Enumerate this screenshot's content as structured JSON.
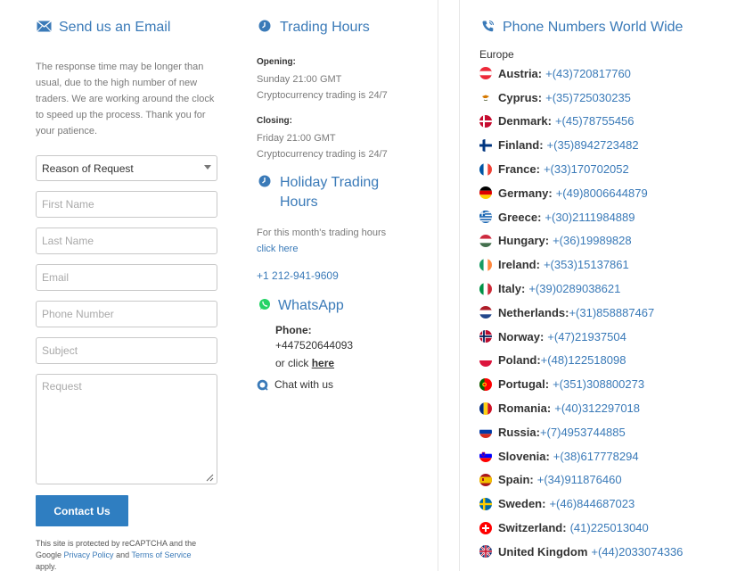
{
  "email_section": {
    "title": "Send us an Email",
    "intro": "The response time may be longer than usual, due to the high number of new traders. We are working around the clock to speed up the process. Thank you for your patience.",
    "select_value": "Reason of Request",
    "placeholders": {
      "first_name": "First Name",
      "last_name": "Last Name",
      "email": "Email",
      "phone": "Phone Number",
      "subject": "Subject",
      "request": "Request"
    },
    "submit_label": "Contact Us",
    "recaptcha_pre": "This site is protected by reCAPTCHA and the Google",
    "privacy_link": "Privacy Policy",
    "and_text": "and",
    "terms_link": "Terms of Service",
    "apply_text": "apply."
  },
  "trading_hours": {
    "title": "Trading Hours",
    "opening_label": "Opening:",
    "opening_time": "Sunday 21:00 GMT",
    "opening_note": "Cryptocurrency trading is 24/7",
    "closing_label": "Closing:",
    "closing_time": "Friday 21:00 GMT",
    "closing_note": "Cryptocurrency trading is 24/7"
  },
  "holiday_hours": {
    "title": "Holiday Trading Hours",
    "text": "For this month's trading hours",
    "link": "click here",
    "phone": "+1 212-941-9609"
  },
  "whatsapp": {
    "title": "WhatsApp",
    "phone_label": "Phone:",
    "phone_number": "+447520644093",
    "or_click": "or click",
    "here_link": "here",
    "chat_label": "Chat with us"
  },
  "phones": {
    "title": "Phone Numbers World Wide",
    "region": "Europe",
    "countries": [
      {
        "name": "Austria:",
        "number": "+(43)720817760",
        "flag": "austria"
      },
      {
        "name": "Cyprus:",
        "number": "+(35)725030235",
        "flag": "cyprus"
      },
      {
        "name": "Denmark:",
        "number": "+(45)78755456",
        "flag": "denmark"
      },
      {
        "name": "Finland:",
        "number": "+(35)8942723482",
        "flag": "finland"
      },
      {
        "name": "France:",
        "number": "+(33)170702052",
        "flag": "france"
      },
      {
        "name": "Germany:",
        "number": "+(49)8006644879",
        "flag": "germany"
      },
      {
        "name": "Greece:",
        "number": "+(30)2111984889",
        "flag": "greece"
      },
      {
        "name": "Hungary:",
        "number": "+(36)19989828",
        "flag": "hungary"
      },
      {
        "name": "Ireland:",
        "number": "+(353)15137861",
        "flag": "ireland"
      },
      {
        "name": "Italy:",
        "number": "+(39)0289038621",
        "flag": "italy"
      },
      {
        "name": "Netherlands:",
        "number": "+(31)858887467",
        "flag": "netherlands"
      },
      {
        "name": "Norway:",
        "number": "+(47)21937504",
        "flag": "norway"
      },
      {
        "name": "Poland:",
        "number": "+(48)122518098",
        "flag": "poland"
      },
      {
        "name": "Portugal:",
        "number": "+(351)308800273",
        "flag": "portugal"
      },
      {
        "name": "Romania:",
        "number": "+(40)312297018",
        "flag": "romania"
      },
      {
        "name": "Russia:",
        "number": "+(7)4953744885",
        "flag": "russia"
      },
      {
        "name": "Slovenia:",
        "number": "+(38)617778294",
        "flag": "slovenia"
      },
      {
        "name": "Spain:",
        "number": "+(34)911876460",
        "flag": "spain"
      },
      {
        "name": "Sweden:",
        "number": "+(46)844687023",
        "flag": "sweden"
      },
      {
        "name": "Switzerland:",
        "number": "(41)225013040",
        "flag": "switzerland"
      },
      {
        "name": "United Kingdom",
        "number": "+(44)2033074336",
        "flag": "uk"
      }
    ]
  },
  "colors": {
    "accent": "#3a7ab8",
    "button": "#2f7ec1",
    "whatsapp": "#25d366"
  }
}
